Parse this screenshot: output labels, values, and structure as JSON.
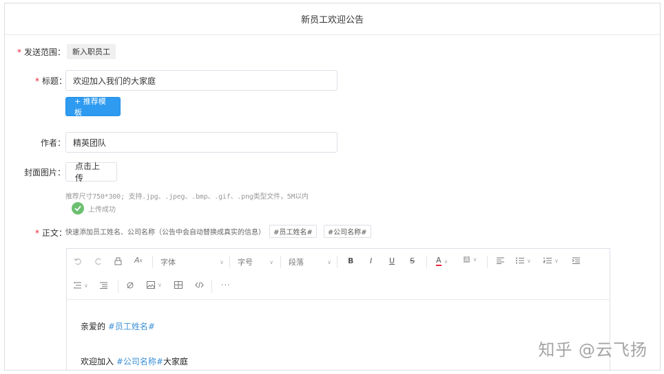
{
  "header": {
    "title": "新员工欢迎公告"
  },
  "form": {
    "scope": {
      "label": "发送范围：",
      "value": "新入职员工"
    },
    "title": {
      "label": "标题：",
      "value": "欢迎加入我们的大家庭"
    },
    "recommend_button": "+ 推荐模板",
    "author": {
      "label": "作者：",
      "value": "精英团队"
    },
    "cover": {
      "label": "封面图片：",
      "upload_button": "点击上传",
      "hint": "推荐尺寸750*300; 支持.jpg、.jpeg、.bmp、.gif、.png类型文件，5M以内",
      "status": "上传成功"
    },
    "body": {
      "label": "正文：",
      "hint": "快速添加员工姓名、公司名称（公告中会自动替换成真实的信息）",
      "var_name": "#员工姓名#",
      "var_company": "#公司名称#"
    }
  },
  "editor": {
    "toolbar": {
      "font": "字体",
      "size": "字号",
      "paragraph": "段落",
      "bold": "B",
      "italic": "I",
      "underline": "U",
      "strike": "S",
      "font_color": "A",
      "bg_color": "A",
      "more": "···"
    },
    "content": {
      "line1_prefix": "亲爱的 ",
      "line1_var": "#员工姓名#",
      "line2_prefix": "欢迎加入 ",
      "line2_var": "#公司名称#",
      "line2_suffix": "大家庭"
    }
  },
  "watermark": "知乎 @云飞扬",
  "colors": {
    "primary": "#2f9bf0",
    "required": "#e23",
    "success": "#6cc070",
    "highlight": "#3a8fd6"
  }
}
